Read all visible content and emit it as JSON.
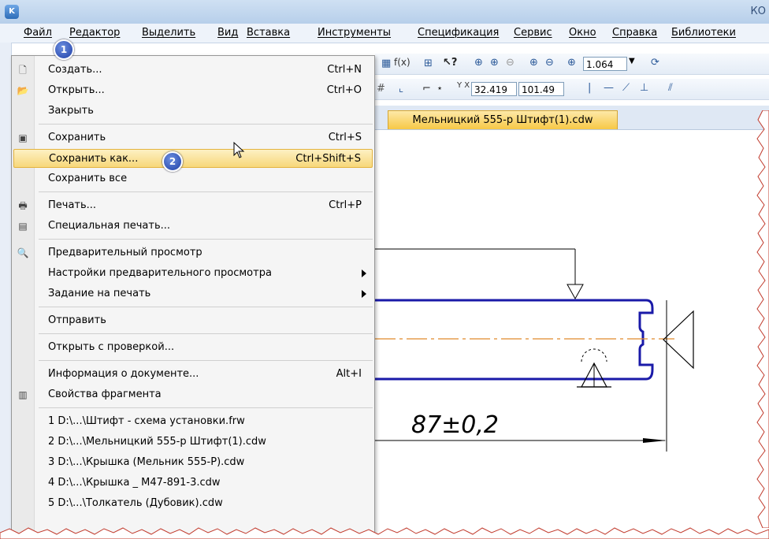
{
  "window": {
    "title": "КО"
  },
  "menubar": {
    "items": [
      "Файл",
      "Редактор",
      "Выделить",
      "Вид",
      "Вставка",
      "Инструменты",
      "Спецификация",
      "Сервис",
      "Окно",
      "Справка",
      "Библиотеки"
    ]
  },
  "toolbar": {
    "zoom_value": "1.064",
    "coord_x": "32.419",
    "coord_y": "101.49"
  },
  "document_tab": {
    "label": "Мельницкий 555-р Штифт(1).cdw"
  },
  "drawing": {
    "dimension_text": "87±0,2"
  },
  "badges": {
    "first": "1",
    "second": "2"
  },
  "file_menu": {
    "items": [
      {
        "label": "Создать...",
        "shortcut": "Ctrl+N",
        "icon": "new-document-icon"
      },
      {
        "label": "Открыть...",
        "shortcut": "Ctrl+O",
        "icon": "open-folder-icon"
      },
      {
        "label": "Закрыть",
        "shortcut": ""
      },
      {
        "label": "Сохранить",
        "shortcut": "Ctrl+S",
        "icon": "save-icon"
      },
      {
        "label": "Сохранить как...",
        "shortcut": "Ctrl+Shift+S",
        "highlighted": true
      },
      {
        "label": "Сохранить все",
        "shortcut": ""
      },
      {
        "label": "Печать...",
        "shortcut": "Ctrl+P",
        "icon": "printer-icon"
      },
      {
        "label": "Специальная печать...",
        "shortcut": "",
        "icon": "special-print-icon"
      },
      {
        "label": "Предварительный просмотр",
        "shortcut": "",
        "icon": "print-preview-icon"
      },
      {
        "label": "Настройки предварительного просмотра",
        "shortcut": "",
        "submenu": true
      },
      {
        "label": "Задание на печать",
        "shortcut": "",
        "submenu": true
      },
      {
        "label": "Отправить",
        "shortcut": ""
      },
      {
        "label": "Открыть с проверкой...",
        "shortcut": ""
      },
      {
        "label": "Информация о документе...",
        "shortcut": "Alt+I"
      },
      {
        "label": "Свойства фрагмента",
        "shortcut": "",
        "icon": "properties-icon"
      },
      {
        "label": "1 D:\\...\\Штифт - схема установки.frw",
        "shortcut": ""
      },
      {
        "label": "2 D:\\...\\Мельницкий 555-р Штифт(1).cdw",
        "shortcut": ""
      },
      {
        "label": "3 D:\\...\\Крышка (Мельник 555-Р).cdw",
        "shortcut": ""
      },
      {
        "label": "4 D:\\...\\Крышка _ М47-891-3.cdw",
        "shortcut": ""
      },
      {
        "label": "5 D:\\...\\Толкатель (Дубовик).cdw",
        "shortcut": ""
      }
    ]
  },
  "colors": {
    "highlight": "#f7d77a",
    "drawing_line": "#1a1aa8",
    "axis_line": "#e08a2a",
    "badge": "#1f3fa6"
  }
}
